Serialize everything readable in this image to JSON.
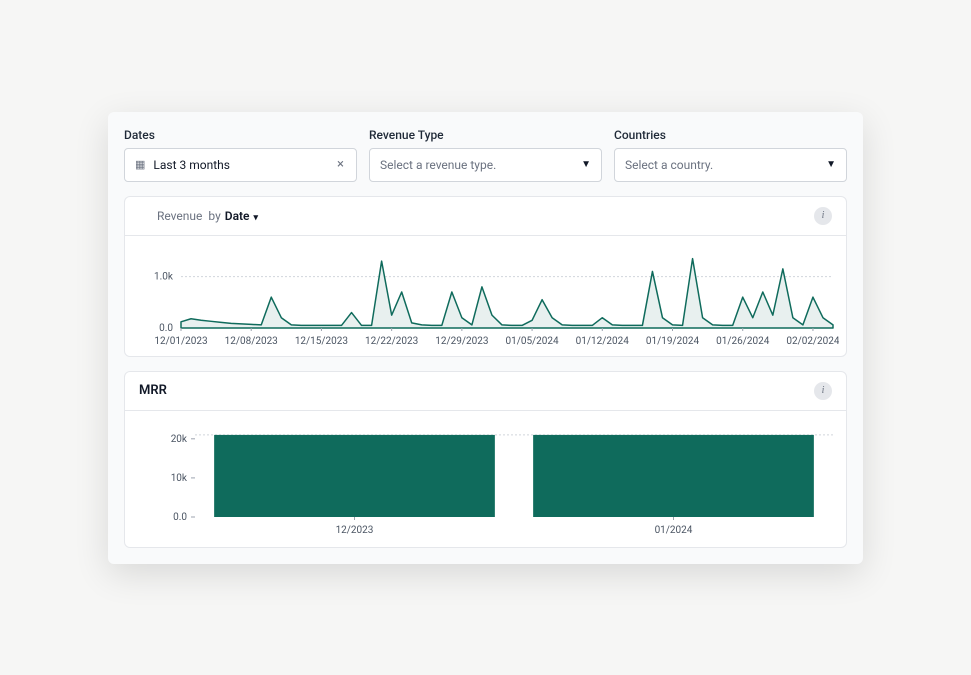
{
  "filters": {
    "dates": {
      "label": "Dates",
      "value": "Last 3 months"
    },
    "revenueType": {
      "label": "Revenue Type",
      "placeholder": "Select a revenue type."
    },
    "countries": {
      "label": "Countries",
      "placeholder": "Select a country."
    }
  },
  "revenueCard": {
    "titlePrefix": "Revenue",
    "by": "by",
    "groupBy": "Date",
    "yticks": [
      "0.0",
      "1.0k"
    ],
    "xticks": [
      "12/01/2023",
      "12/08/2023",
      "12/15/2023",
      "12/22/2023",
      "12/29/2023",
      "01/05/2024",
      "01/12/2024",
      "01/19/2024",
      "01/26/2024",
      "02/02/2024"
    ]
  },
  "mrrCard": {
    "title": "MRR",
    "yticks": [
      "0.0",
      "10k",
      "20k"
    ],
    "xticks": [
      "12/2023",
      "01/2024"
    ]
  },
  "chart_data": [
    {
      "type": "area",
      "title": "Revenue by Date",
      "xlabel": "",
      "ylabel": "",
      "ylim": [
        0,
        1400
      ],
      "x": [
        "12/01/2023",
        "12/02/2023",
        "12/03/2023",
        "12/04/2023",
        "12/05/2023",
        "12/06/2023",
        "12/07/2023",
        "12/08/2023",
        "12/09/2023",
        "12/10/2023",
        "12/11/2023",
        "12/12/2023",
        "12/13/2023",
        "12/14/2023",
        "12/15/2023",
        "12/16/2023",
        "12/17/2023",
        "12/18/2023",
        "12/19/2023",
        "12/20/2023",
        "12/21/2023",
        "12/22/2023",
        "12/23/2023",
        "12/24/2023",
        "12/25/2023",
        "12/26/2023",
        "12/27/2023",
        "12/28/2023",
        "12/29/2023",
        "12/30/2023",
        "12/31/2023",
        "01/01/2024",
        "01/02/2024",
        "01/03/2024",
        "01/04/2024",
        "01/05/2024",
        "01/06/2024",
        "01/07/2024",
        "01/08/2024",
        "01/09/2024",
        "01/10/2024",
        "01/11/2024",
        "01/12/2024",
        "01/13/2024",
        "01/14/2024",
        "01/15/2024",
        "01/16/2024",
        "01/17/2024",
        "01/18/2024",
        "01/19/2024",
        "01/20/2024",
        "01/21/2024",
        "01/22/2024",
        "01/23/2024",
        "01/24/2024",
        "01/25/2024",
        "01/26/2024",
        "01/27/2024",
        "01/28/2024",
        "01/29/2024",
        "01/30/2024",
        "01/31/2024",
        "02/01/2024",
        "02/02/2024",
        "02/03/2024",
        "02/04/2024"
      ],
      "values": [
        120,
        180,
        150,
        130,
        110,
        90,
        80,
        70,
        60,
        600,
        200,
        60,
        50,
        50,
        50,
        50,
        50,
        300,
        50,
        50,
        1300,
        250,
        700,
        100,
        60,
        50,
        50,
        700,
        200,
        60,
        800,
        250,
        60,
        50,
        50,
        150,
        550,
        200,
        60,
        50,
        50,
        50,
        200,
        60,
        50,
        50,
        50,
        1100,
        200,
        60,
        50,
        1350,
        200,
        60,
        50,
        50,
        600,
        200,
        700,
        250,
        1150,
        200,
        60,
        600,
        200,
        60
      ]
    },
    {
      "type": "bar",
      "title": "MRR",
      "xlabel": "",
      "ylabel": "",
      "ylim": [
        0,
        22000
      ],
      "categories": [
        "12/2023",
        "01/2024"
      ],
      "values": [
        21000,
        21000
      ]
    }
  ]
}
